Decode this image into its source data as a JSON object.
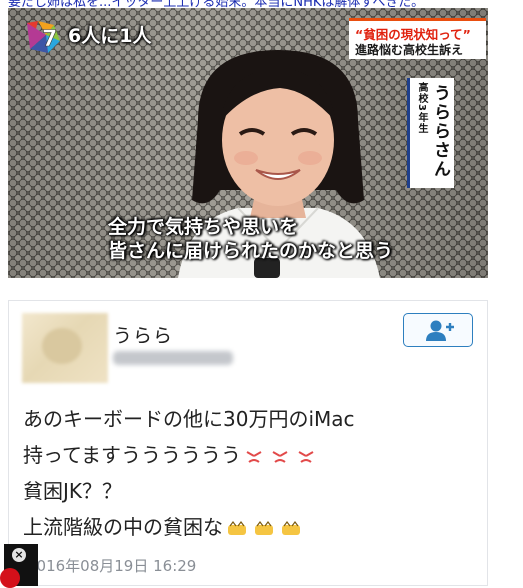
{
  "page": {
    "top_text": "要だし姉は私を...イッター上上げる始末。本当にNHKは解体すべきだ。"
  },
  "tv": {
    "topic_label": "6人に1人",
    "headline_line1": "“貧困の現状知って”",
    "headline_line2": "進路悩む高校生訴え",
    "grade": "高校3年生",
    "name": "うららさん",
    "subtitle_line1": "全力で気持ちや思いを",
    "subtitle_line2": "皆さんに届けられたのかなと思う",
    "logo_number": "7"
  },
  "tweet": {
    "display_name": "うらら",
    "lines": [
      "あのキーボードの他に30万円のiMac",
      "持ってますうううううう",
      "貧困JK？？",
      "上流階級の中の貧困な"
    ],
    "timestamp": "2016年08月19日 16:29",
    "follow_icon": "add-user-icon",
    "colors": {
      "follow": "#2e7fbf",
      "angry_emoji": "#e24a4a",
      "smile_emoji": "#f5c542"
    }
  }
}
